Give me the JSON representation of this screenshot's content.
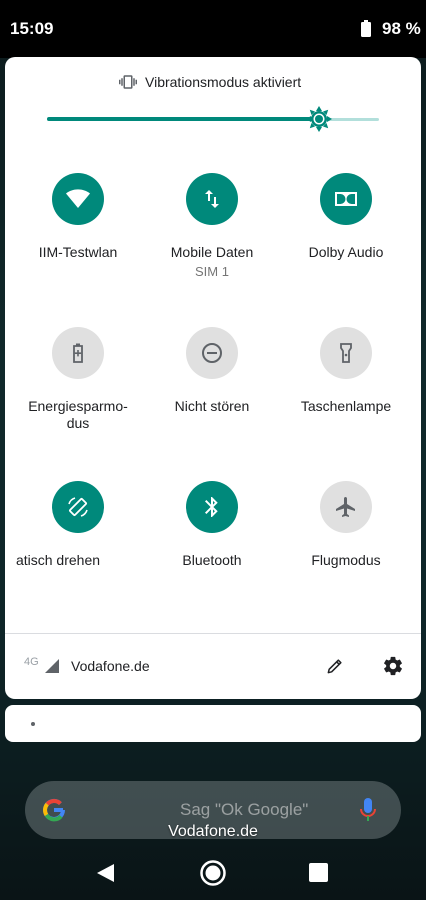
{
  "status_bar": {
    "time": "15:09",
    "battery": "98 %"
  },
  "quick_settings": {
    "sound_mode": "Vibrationsmodus aktiviert",
    "brightness": 0.82,
    "tiles": [
      {
        "label": "IIM-Testwlan",
        "sublabel": "",
        "icon": "wifi-icon",
        "active": true
      },
      {
        "label": "Mobile Daten",
        "sublabel": "SIM 1",
        "icon": "mobile-data-icon",
        "active": true
      },
      {
        "label": "Dolby Audio",
        "sublabel": "",
        "icon": "dolby-icon",
        "active": true
      },
      {
        "label": "Energiesparmo-\ndus",
        "sublabel": "",
        "icon": "battery-saver-icon",
        "active": false
      },
      {
        "label": "Nicht stören",
        "sublabel": "",
        "icon": "do-not-disturb-icon",
        "active": false
      },
      {
        "label": "Taschenlampe",
        "sublabel": "",
        "icon": "flashlight-icon",
        "active": false
      },
      {
        "label": "atisch drehen",
        "sublabel": "",
        "icon": "auto-rotate-icon",
        "active": true
      },
      {
        "label": "Bluetooth",
        "sublabel": "",
        "icon": "bluetooth-icon",
        "active": true
      },
      {
        "label": "Flugmodus",
        "sublabel": "",
        "icon": "airplane-icon",
        "active": false
      }
    ],
    "footer": {
      "network_type": "4G",
      "carrier": "Vodafone.de"
    }
  },
  "home": {
    "search_hint": "Sag \"Ok Google\"",
    "carrier_label": "Vodafone.de"
  },
  "colors": {
    "accent": "#00897b",
    "accent_light": "#b2dfdb",
    "tile_off": "#e0e0e0"
  }
}
